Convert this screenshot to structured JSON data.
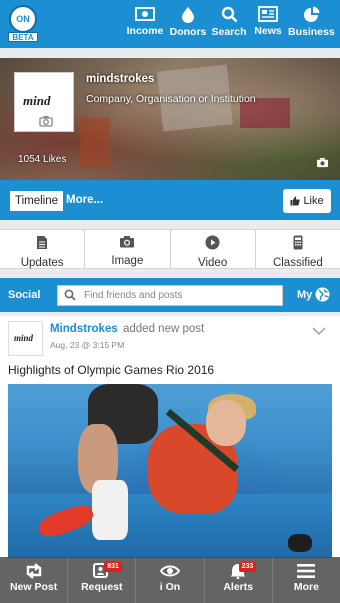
{
  "top_nav": {
    "logo_text": "ON",
    "logo_badge": "BETA",
    "items": [
      {
        "label": "Income",
        "icon": "money-icon"
      },
      {
        "label": "Donors",
        "icon": "drop-icon"
      },
      {
        "label": "Search",
        "icon": "search-icon"
      },
      {
        "label": "News",
        "icon": "newspaper-icon"
      },
      {
        "label": "Business",
        "icon": "pie-chart-icon"
      }
    ]
  },
  "profile": {
    "name": "mindstrokes",
    "category": "Company, Organisation or Institution",
    "likes": "1054 Likes",
    "logo_text": "mind",
    "timeline_label": "Timeline",
    "more_label": "More...",
    "like_label": "Like"
  },
  "actions": [
    {
      "label": "Updates",
      "icon": "document-icon"
    },
    {
      "label": "Image",
      "icon": "camera-icon"
    },
    {
      "label": "Video",
      "icon": "play-icon"
    },
    {
      "label": "Classified",
      "icon": "phone-icon"
    }
  ],
  "social": {
    "label": "Social",
    "search_placeholder": "Find friends and posts",
    "my_label": "My"
  },
  "post": {
    "author": "Mindstrokes",
    "action": "added new post",
    "time": "Aug, 23 @ 3:15 PM",
    "text": "Highlights of Olympic Games Rio 2016",
    "avatar_text": "mind"
  },
  "bottom_nav": [
    {
      "label": "New Post",
      "icon": "retweet-icon",
      "badge": ""
    },
    {
      "label": "Request",
      "icon": "request-icon",
      "badge": "831"
    },
    {
      "label": "i On",
      "icon": "eye-icon",
      "badge": ""
    },
    {
      "label": "Alerts",
      "icon": "bell-icon",
      "badge": "233"
    },
    {
      "label": "More",
      "icon": "menu-icon",
      "badge": ""
    }
  ],
  "colors": {
    "brand_blue": "#1b8fd2",
    "badge_red": "#e0201b",
    "background": "#e9ebee"
  }
}
